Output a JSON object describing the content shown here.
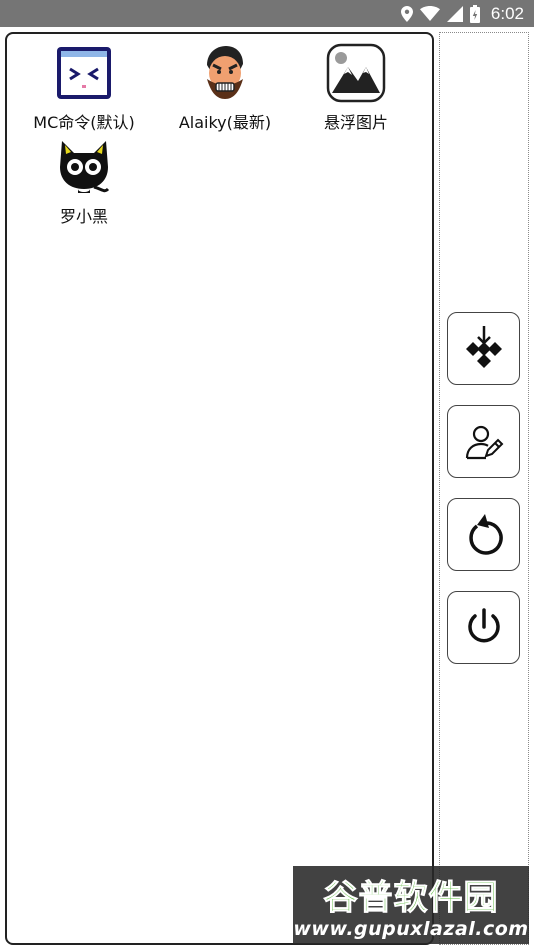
{
  "status_bar": {
    "time": "6:02",
    "icons": [
      "location-icon",
      "wifi-icon",
      "signal-icon",
      "battery-charging-icon"
    ]
  },
  "apps": [
    {
      "label": "MC命令(默认)",
      "icon": "mc-command-icon"
    },
    {
      "label": "Alaiky(最新)",
      "icon": "alaiky-character-icon"
    },
    {
      "label": "悬浮图片",
      "icon": "floating-image-icon"
    },
    {
      "label": "罗小黑",
      "icon": "black-cat-icon"
    }
  ],
  "side_buttons": [
    {
      "icon": "collapse-arrows-icon"
    },
    {
      "icon": "user-edit-icon"
    },
    {
      "icon": "refresh-icon"
    },
    {
      "icon": "power-icon"
    }
  ],
  "watermark": {
    "logo": "谷普软件园",
    "url": "www.gupuxlazal.com"
  }
}
